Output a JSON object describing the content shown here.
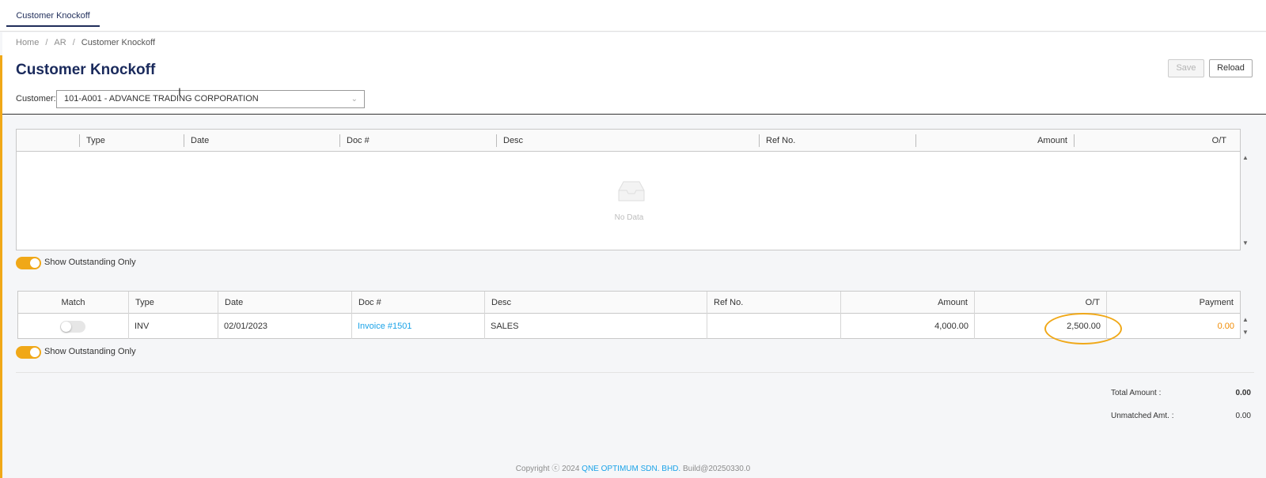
{
  "tabs": [
    {
      "label": "Customer Knockoff"
    }
  ],
  "breadcrumb": [
    "Home",
    "AR",
    "Customer Knockoff"
  ],
  "page_title": "Customer Knockoff",
  "toolbar": {
    "save_label": "Save",
    "reload_label": "Reload"
  },
  "customer": {
    "label": "Customer:",
    "value": "101-A001 - ADVANCE TRADING CORPORATION"
  },
  "grid1": {
    "columns": [
      "Type",
      "Date",
      "Doc #",
      "Desc",
      "Ref No.",
      "Amount",
      "O/T"
    ],
    "empty_text": "No Data"
  },
  "toggle1": {
    "label": "Show Outstanding Only",
    "on": true
  },
  "grid2": {
    "columns": [
      "Match",
      "Type",
      "Date",
      "Doc #",
      "Desc",
      "Ref No.",
      "Amount",
      "O/T",
      "Payment"
    ],
    "rows": [
      {
        "match": false,
        "type": "INV",
        "date": "02/01/2023",
        "doc": "Invoice #1501",
        "desc": "SALES",
        "ref": "",
        "amount": "4,000.00",
        "ot": "2,500.00",
        "payment": "0.00"
      }
    ]
  },
  "toggle2": {
    "label": "Show Outstanding Only",
    "on": true
  },
  "summary": {
    "total_label": "Total Amount :",
    "total_value": "0.00",
    "unmatched_label": "Unmatched Amt. :",
    "unmatched_value": "0.00"
  },
  "footer": {
    "prefix": "Copyright ⓒ 2024",
    "company": "QNE OPTIMUM SDN. BHD.",
    "build": "Build@20250330.0"
  },
  "colors": {
    "accent": "#f0a818",
    "title": "#1a2a5c",
    "link": "#1aa3e8",
    "payment": "#f08a00"
  }
}
